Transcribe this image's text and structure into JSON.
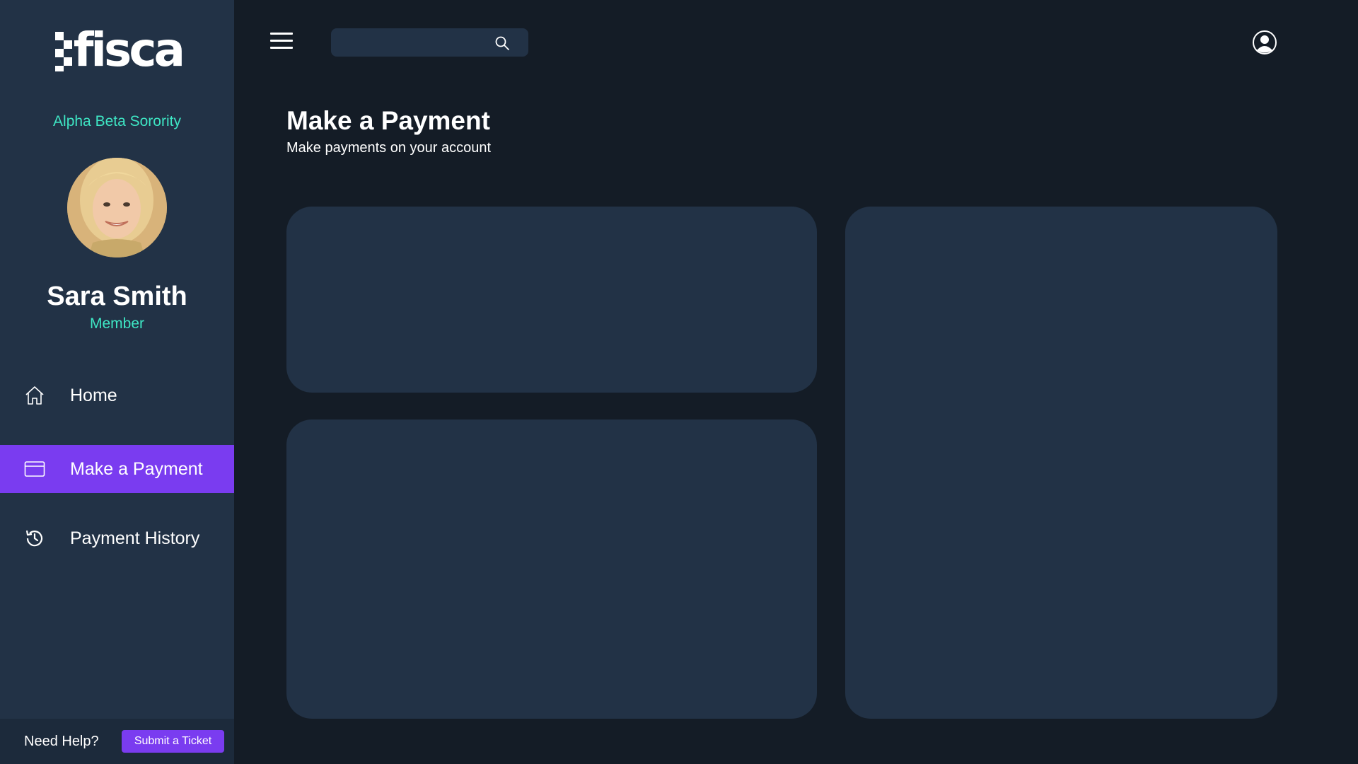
{
  "brand": {
    "logo_text": "fisca"
  },
  "sidebar": {
    "org_name": "Alpha Beta Sorority",
    "user": {
      "name": "Sara Smith",
      "role": "Member"
    },
    "items": [
      {
        "label": "Home",
        "icon": "home-icon",
        "active": false
      },
      {
        "label": "Make a Payment",
        "icon": "credit-card-icon",
        "active": true
      },
      {
        "label": "Payment History",
        "icon": "history-icon",
        "active": false
      }
    ],
    "help": {
      "text": "Need Help?",
      "button_label": "Submit a Ticket"
    }
  },
  "topbar": {
    "menu_icon": "hamburger-icon",
    "search": {
      "placeholder": "",
      "value": "",
      "icon": "search-icon"
    },
    "profile_icon": "user-circle-icon"
  },
  "main": {
    "title": "Make a Payment",
    "subtitle": "Make payments on your account"
  },
  "colors": {
    "background": "#141c26",
    "sidebar": "#223246",
    "card": "#223246",
    "accent": "#7a3cf0",
    "teal": "#3ee6c4"
  }
}
